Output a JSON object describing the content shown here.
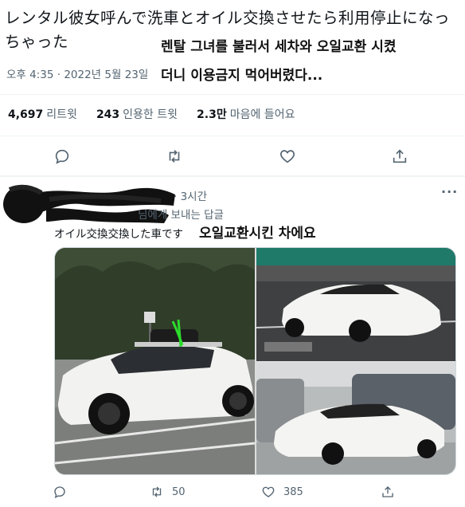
{
  "tweet": {
    "text_jp": "レンタル彼女呼んで洗車とオイル交換させたら利用停止になっちゃった",
    "overlay_ko_1": "렌탈 그녀를 불러서 세차와 오일교환 시켰",
    "overlay_ko_2": "더니 이용금지 먹어버렸다...",
    "time": "오후 4:35 · 2022년 5월 23일"
  },
  "stats": {
    "retweets_count": "4,697",
    "retweets_label": "리트윗",
    "quotes_count": "243",
    "quotes_label": "인용한 트윗",
    "likes_count": "2.3만",
    "likes_label": "마음에 들어요"
  },
  "actions": {
    "reply_icon": "reply-icon",
    "retweet_icon": "retweet-icon",
    "like_icon": "heart-icon",
    "share_icon": "share-icon"
  },
  "reply": {
    "time": "· 3시간",
    "reply_to": "님에게 보내는 답글",
    "text_jp": "オイル交換交換した車です",
    "text_ko": "오일교환시킨 차에요",
    "more": "···",
    "retweet_count": "50",
    "like_count": "385"
  },
  "colors": {
    "text": "#0f1419",
    "secondary": "#536471",
    "divider": "#eff3f4"
  }
}
